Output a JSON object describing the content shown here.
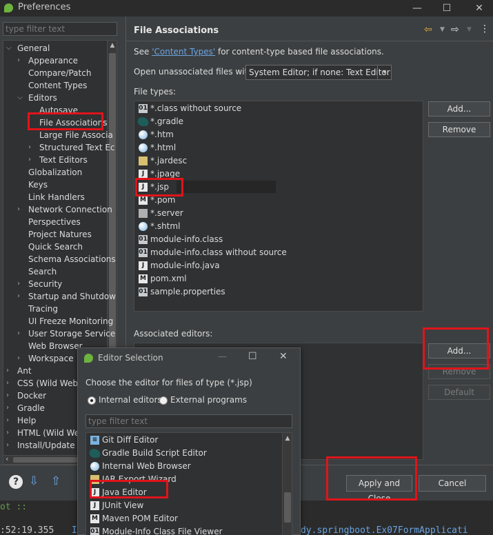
{
  "window": {
    "title": "Preferences",
    "minimize": "—",
    "maximize": "☐",
    "close": "✕"
  },
  "sidebar": {
    "filter_placeholder": "type filter text",
    "items": [
      {
        "label": "General",
        "level": 0,
        "twisty": "down"
      },
      {
        "label": "Appearance",
        "level": 1,
        "twisty": "right"
      },
      {
        "label": "Compare/Patch",
        "level": 1,
        "twisty": ""
      },
      {
        "label": "Content Types",
        "level": 1,
        "twisty": ""
      },
      {
        "label": "Editors",
        "level": 1,
        "twisty": "down"
      },
      {
        "label": "Autosave",
        "level": 2,
        "twisty": ""
      },
      {
        "label": "File Associations",
        "level": 2,
        "twisty": ""
      },
      {
        "label": "Large File Associa",
        "level": 2,
        "twisty": ""
      },
      {
        "label": "Structured Text Ec",
        "level": 2,
        "twisty": "right"
      },
      {
        "label": "Text Editors",
        "level": 2,
        "twisty": "right"
      },
      {
        "label": "Globalization",
        "level": 1,
        "twisty": ""
      },
      {
        "label": "Keys",
        "level": 1,
        "twisty": ""
      },
      {
        "label": "Link Handlers",
        "level": 1,
        "twisty": ""
      },
      {
        "label": "Network Connection",
        "level": 1,
        "twisty": "right"
      },
      {
        "label": "Perspectives",
        "level": 1,
        "twisty": ""
      },
      {
        "label": "Project Natures",
        "level": 1,
        "twisty": ""
      },
      {
        "label": "Quick Search",
        "level": 1,
        "twisty": ""
      },
      {
        "label": "Schema Associations",
        "level": 1,
        "twisty": ""
      },
      {
        "label": "Search",
        "level": 1,
        "twisty": ""
      },
      {
        "label": "Security",
        "level": 1,
        "twisty": "right"
      },
      {
        "label": "Startup and Shutdow",
        "level": 1,
        "twisty": "right"
      },
      {
        "label": "Tracing",
        "level": 1,
        "twisty": ""
      },
      {
        "label": "UI Freeze Monitoring",
        "level": 1,
        "twisty": ""
      },
      {
        "label": "User Storage Service",
        "level": 1,
        "twisty": "right"
      },
      {
        "label": "Web Browser",
        "level": 1,
        "twisty": ""
      },
      {
        "label": "Workspace",
        "level": 1,
        "twisty": "right"
      },
      {
        "label": "Ant",
        "level": 0,
        "twisty": "right"
      },
      {
        "label": "CSS (Wild Web",
        "level": 0,
        "twisty": "right"
      },
      {
        "label": "Docker",
        "level": 0,
        "twisty": "right"
      },
      {
        "label": "Gradle",
        "level": 0,
        "twisty": "right"
      },
      {
        "label": "Help",
        "level": 0,
        "twisty": "right"
      },
      {
        "label": "HTML (Wild Web",
        "level": 0,
        "twisty": "right"
      },
      {
        "label": "Install/Update",
        "level": 0,
        "twisty": "right"
      }
    ]
  },
  "main": {
    "title": "File Associations",
    "see_prefix": "See ",
    "see_link": "'Content Types'",
    "see_suffix": " for content-type based file associations.",
    "open_unassoc_label": "Open unassociated files with:",
    "open_unassoc_value": "System Editor; if none: Text Editor",
    "file_types_label": "File types:",
    "file_types": [
      {
        "label": "*.class without source",
        "icon": "class-file-icon",
        "color": "#c8ccd0"
      },
      {
        "label": "*.gradle",
        "icon": "gradle-icon",
        "color": "#1e5d5a"
      },
      {
        "label": "*.htm",
        "icon": "globe-icon",
        "color": "#7cb3e0"
      },
      {
        "label": "*.html",
        "icon": "globe-icon",
        "color": "#7cb3e0"
      },
      {
        "label": "*.jardesc",
        "icon": "jar-icon",
        "color": "#d8c070"
      },
      {
        "label": "*.jpage",
        "icon": "java-page-icon",
        "color": "#e8e8e8"
      },
      {
        "label": "*.jsp",
        "icon": "java-file-icon",
        "color": "#e8e8e8"
      },
      {
        "label": "*.pom",
        "icon": "maven-icon",
        "color": "#e8e8e8"
      },
      {
        "label": "*.server",
        "icon": "server-icon",
        "color": "#b0b0b0"
      },
      {
        "label": "*.shtml",
        "icon": "globe-icon",
        "color": "#7cb3e0"
      },
      {
        "label": "module-info.class",
        "icon": "class-file-icon",
        "color": "#c8ccd0"
      },
      {
        "label": "module-info.class without source",
        "icon": "class-file-icon",
        "color": "#c8ccd0"
      },
      {
        "label": "module-info.java",
        "icon": "java-file-icon",
        "color": "#e8e8e8"
      },
      {
        "label": "pom.xml",
        "icon": "maven-icon",
        "color": "#e8e8e8"
      },
      {
        "label": "sample.properties",
        "icon": "properties-icon",
        "color": "#c8ccd0"
      }
    ],
    "file_type_icon_glyphs": {
      "class-file-icon": "01",
      "gradle-icon": "",
      "globe-icon": "",
      "jar-icon": "",
      "java-page-icon": "J",
      "java-file-icon": "J",
      "maven-icon": "M",
      "server-icon": "",
      "properties-icon": "01"
    },
    "add_label": "Add...",
    "remove_label": "Remove",
    "associated_editors_label": "Associated editors:",
    "editor_add_label": "Add...",
    "editor_remove_label": "Remove",
    "default_label": "Default"
  },
  "bottom": {
    "apply_close_label": "Apply and Close",
    "cancel_label": "Cancel"
  },
  "console": {
    "line1": "ot ::",
    "line2_time": ":52:19.355",
    "line2_level": "I",
    "line2_class": "dy.springboot.Ex07FormApplicati"
  },
  "dialog": {
    "title": "Editor Selection",
    "prompt": "Choose the editor for files of type (*.jsp)",
    "internal_label": "Internal editors",
    "external_label": "External programs",
    "filter_placeholder": "type filter text",
    "editors": [
      {
        "label": "Git Diff Editor",
        "icon": "git-diff-icon",
        "color": "#7cb3e0",
        "glyph": "≡"
      },
      {
        "label": "Gradle Build Script Editor",
        "icon": "gradle-icon",
        "color": "#1e5d5a",
        "glyph": ""
      },
      {
        "label": "Internal Web Browser",
        "icon": "globe-icon",
        "color": "#7cb3e0",
        "glyph": ""
      },
      {
        "label": "JAR Export Wizard",
        "icon": "jar-icon",
        "color": "#d8c070",
        "glyph": ""
      },
      {
        "label": "Java Editor",
        "icon": "java-file-icon",
        "color": "#e8e8e8",
        "glyph": "J"
      },
      {
        "label": "JUnit View",
        "icon": "junit-icon",
        "color": "#e8e8e8",
        "glyph": "J"
      },
      {
        "label": "Maven POM Editor",
        "icon": "maven-icon",
        "color": "#e8e8e8",
        "glyph": "M"
      },
      {
        "label": "Module-Info Class File Viewer",
        "icon": "class-file-icon",
        "color": "#c8ccd0",
        "glyph": "01"
      },
      {
        "label": "Module-Info Class File Viewer",
        "icon": "class-file-icon",
        "color": "#c8ccd0",
        "glyph": "01"
      }
    ]
  },
  "colors": {
    "highlight": "#e0141a",
    "link": "#6aa5e3",
    "brand_leaf": "#6db33f"
  }
}
